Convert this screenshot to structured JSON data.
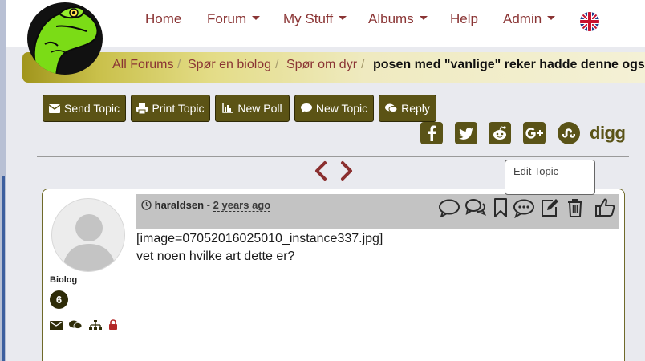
{
  "nav": {
    "items": [
      {
        "label": "Home",
        "dropdown": false
      },
      {
        "label": "Forum",
        "dropdown": true
      },
      {
        "label": "My Stuff",
        "dropdown": true
      },
      {
        "label": "Albums",
        "dropdown": true
      },
      {
        "label": "Help",
        "dropdown": false
      },
      {
        "label": "Admin",
        "dropdown": true
      }
    ],
    "language_icon": "uk-flag-icon"
  },
  "breadcrumb": {
    "items": [
      "All Forums",
      "Spør en biolog",
      "Spør om dyr"
    ],
    "separator": "/",
    "current": "posen med \"vanlige\" reker hadde denne også"
  },
  "actions": {
    "send_topic": "Send Topic",
    "print_topic": "Print Topic",
    "new_poll": "New Poll",
    "new_topic": "New Topic",
    "reply": "Reply"
  },
  "social": {
    "icons": [
      "facebook-icon",
      "twitter-icon",
      "reddit-icon",
      "google-plus-icon",
      "stumbleupon-icon"
    ],
    "digg_label": "digg"
  },
  "tooltip": "Edit Topic",
  "post": {
    "author": "haraldsen",
    "separator": "-",
    "time": "2 years ago",
    "role": "Biolog",
    "post_count": "6",
    "body_line1": "[image=07052016025010_instance337.jpg]",
    "body_line2": "vet noen hvilke art dette er?"
  },
  "colors": {
    "accent": "#5b5315",
    "link": "#8a3434",
    "header_gray": "#c3c3c3"
  }
}
